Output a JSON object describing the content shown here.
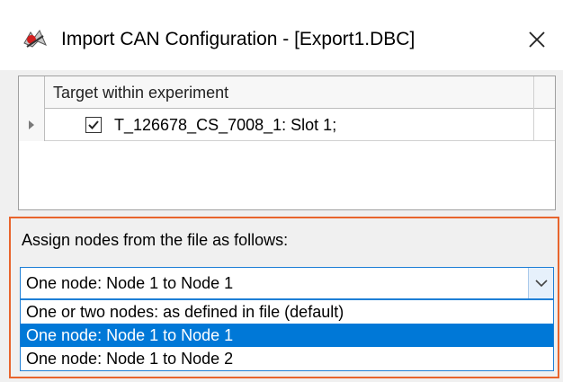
{
  "window": {
    "title": "Import CAN Configuration - [Export1.DBC]",
    "app_icon": "can-logo-icon",
    "close_icon": "close-icon"
  },
  "grid": {
    "column_header": "Target within experiment",
    "rows": [
      {
        "checked": true,
        "label": "T_126678_CS_7008_1: Slot 1;"
      }
    ]
  },
  "assign": {
    "label": "Assign nodes from the file as follows:",
    "selected_value": "One node: Node 1 to Node 1",
    "options": [
      "One or two nodes: as defined in file (default)",
      "One node: Node 1 to Node 1",
      "One node: Node 1 to Node 2"
    ],
    "highlight_color": "#e8642c",
    "selection_color": "#0078d7"
  }
}
